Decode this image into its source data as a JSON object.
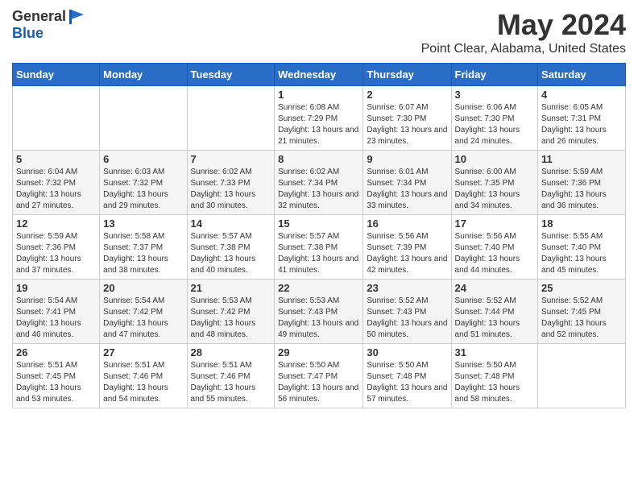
{
  "header": {
    "logo_general": "General",
    "logo_blue": "Blue",
    "main_title": "May 2024",
    "subtitle": "Point Clear, Alabama, United States"
  },
  "weekdays": [
    "Sunday",
    "Monday",
    "Tuesday",
    "Wednesday",
    "Thursday",
    "Friday",
    "Saturday"
  ],
  "weeks": [
    [
      {
        "day": "",
        "sunrise": "",
        "sunset": "",
        "daylight": ""
      },
      {
        "day": "",
        "sunrise": "",
        "sunset": "",
        "daylight": ""
      },
      {
        "day": "",
        "sunrise": "",
        "sunset": "",
        "daylight": ""
      },
      {
        "day": "1",
        "sunrise": "Sunrise: 6:08 AM",
        "sunset": "Sunset: 7:29 PM",
        "daylight": "Daylight: 13 hours and 21 minutes."
      },
      {
        "day": "2",
        "sunrise": "Sunrise: 6:07 AM",
        "sunset": "Sunset: 7:30 PM",
        "daylight": "Daylight: 13 hours and 23 minutes."
      },
      {
        "day": "3",
        "sunrise": "Sunrise: 6:06 AM",
        "sunset": "Sunset: 7:30 PM",
        "daylight": "Daylight: 13 hours and 24 minutes."
      },
      {
        "day": "4",
        "sunrise": "Sunrise: 6:05 AM",
        "sunset": "Sunset: 7:31 PM",
        "daylight": "Daylight: 13 hours and 26 minutes."
      }
    ],
    [
      {
        "day": "5",
        "sunrise": "Sunrise: 6:04 AM",
        "sunset": "Sunset: 7:32 PM",
        "daylight": "Daylight: 13 hours and 27 minutes."
      },
      {
        "day": "6",
        "sunrise": "Sunrise: 6:03 AM",
        "sunset": "Sunset: 7:32 PM",
        "daylight": "Daylight: 13 hours and 29 minutes."
      },
      {
        "day": "7",
        "sunrise": "Sunrise: 6:02 AM",
        "sunset": "Sunset: 7:33 PM",
        "daylight": "Daylight: 13 hours and 30 minutes."
      },
      {
        "day": "8",
        "sunrise": "Sunrise: 6:02 AM",
        "sunset": "Sunset: 7:34 PM",
        "daylight": "Daylight: 13 hours and 32 minutes."
      },
      {
        "day": "9",
        "sunrise": "Sunrise: 6:01 AM",
        "sunset": "Sunset: 7:34 PM",
        "daylight": "Daylight: 13 hours and 33 minutes."
      },
      {
        "day": "10",
        "sunrise": "Sunrise: 6:00 AM",
        "sunset": "Sunset: 7:35 PM",
        "daylight": "Daylight: 13 hours and 34 minutes."
      },
      {
        "day": "11",
        "sunrise": "Sunrise: 5:59 AM",
        "sunset": "Sunset: 7:36 PM",
        "daylight": "Daylight: 13 hours and 36 minutes."
      }
    ],
    [
      {
        "day": "12",
        "sunrise": "Sunrise: 5:59 AM",
        "sunset": "Sunset: 7:36 PM",
        "daylight": "Daylight: 13 hours and 37 minutes."
      },
      {
        "day": "13",
        "sunrise": "Sunrise: 5:58 AM",
        "sunset": "Sunset: 7:37 PM",
        "daylight": "Daylight: 13 hours and 38 minutes."
      },
      {
        "day": "14",
        "sunrise": "Sunrise: 5:57 AM",
        "sunset": "Sunset: 7:38 PM",
        "daylight": "Daylight: 13 hours and 40 minutes."
      },
      {
        "day": "15",
        "sunrise": "Sunrise: 5:57 AM",
        "sunset": "Sunset: 7:38 PM",
        "daylight": "Daylight: 13 hours and 41 minutes."
      },
      {
        "day": "16",
        "sunrise": "Sunrise: 5:56 AM",
        "sunset": "Sunset: 7:39 PM",
        "daylight": "Daylight: 13 hours and 42 minutes."
      },
      {
        "day": "17",
        "sunrise": "Sunrise: 5:56 AM",
        "sunset": "Sunset: 7:40 PM",
        "daylight": "Daylight: 13 hours and 44 minutes."
      },
      {
        "day": "18",
        "sunrise": "Sunrise: 5:55 AM",
        "sunset": "Sunset: 7:40 PM",
        "daylight": "Daylight: 13 hours and 45 minutes."
      }
    ],
    [
      {
        "day": "19",
        "sunrise": "Sunrise: 5:54 AM",
        "sunset": "Sunset: 7:41 PM",
        "daylight": "Daylight: 13 hours and 46 minutes."
      },
      {
        "day": "20",
        "sunrise": "Sunrise: 5:54 AM",
        "sunset": "Sunset: 7:42 PM",
        "daylight": "Daylight: 13 hours and 47 minutes."
      },
      {
        "day": "21",
        "sunrise": "Sunrise: 5:53 AM",
        "sunset": "Sunset: 7:42 PM",
        "daylight": "Daylight: 13 hours and 48 minutes."
      },
      {
        "day": "22",
        "sunrise": "Sunrise: 5:53 AM",
        "sunset": "Sunset: 7:43 PM",
        "daylight": "Daylight: 13 hours and 49 minutes."
      },
      {
        "day": "23",
        "sunrise": "Sunrise: 5:52 AM",
        "sunset": "Sunset: 7:43 PM",
        "daylight": "Daylight: 13 hours and 50 minutes."
      },
      {
        "day": "24",
        "sunrise": "Sunrise: 5:52 AM",
        "sunset": "Sunset: 7:44 PM",
        "daylight": "Daylight: 13 hours and 51 minutes."
      },
      {
        "day": "25",
        "sunrise": "Sunrise: 5:52 AM",
        "sunset": "Sunset: 7:45 PM",
        "daylight": "Daylight: 13 hours and 52 minutes."
      }
    ],
    [
      {
        "day": "26",
        "sunrise": "Sunrise: 5:51 AM",
        "sunset": "Sunset: 7:45 PM",
        "daylight": "Daylight: 13 hours and 53 minutes."
      },
      {
        "day": "27",
        "sunrise": "Sunrise: 5:51 AM",
        "sunset": "Sunset: 7:46 PM",
        "daylight": "Daylight: 13 hours and 54 minutes."
      },
      {
        "day": "28",
        "sunrise": "Sunrise: 5:51 AM",
        "sunset": "Sunset: 7:46 PM",
        "daylight": "Daylight: 13 hours and 55 minutes."
      },
      {
        "day": "29",
        "sunrise": "Sunrise: 5:50 AM",
        "sunset": "Sunset: 7:47 PM",
        "daylight": "Daylight: 13 hours and 56 minutes."
      },
      {
        "day": "30",
        "sunrise": "Sunrise: 5:50 AM",
        "sunset": "Sunset: 7:48 PM",
        "daylight": "Daylight: 13 hours and 57 minutes."
      },
      {
        "day": "31",
        "sunrise": "Sunrise: 5:50 AM",
        "sunset": "Sunset: 7:48 PM",
        "daylight": "Daylight: 13 hours and 58 minutes."
      },
      {
        "day": "",
        "sunrise": "",
        "sunset": "",
        "daylight": ""
      }
    ]
  ]
}
